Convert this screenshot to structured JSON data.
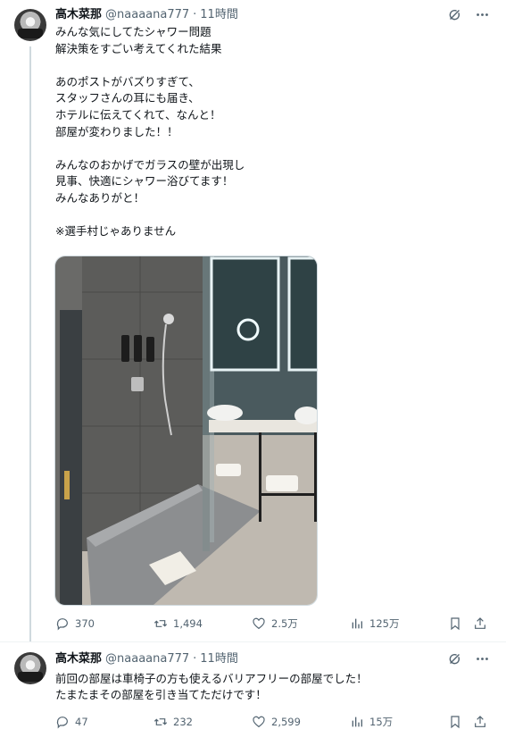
{
  "tweets": [
    {
      "author_name": "高木菜那",
      "handle": "@naaaana777",
      "separator": "·",
      "time": "11時間",
      "text": "みんな気にしてたシャワー問題\n解決策をすごい考えてくれた結果\n\nあのポストがバズりすぎて、\nスタッフさんの耳にも届き、\nホテルに伝えてくれて、なんと！\n部屋が変わりました！！\n\nみんなのおかげでガラスの壁が出現し\n見事、快適にシャワー浴びてます！\nみんなありがと！\n\n※選手村じゃありません",
      "stats": {
        "replies": "370",
        "reposts": "1,494",
        "likes": "2.5万",
        "views": "125万"
      }
    },
    {
      "author_name": "高木菜那",
      "handle": "@naaaana777",
      "separator": "·",
      "time": "11時間",
      "text": "前回の部屋は車椅子の方も使えるバリアフリーの部屋でした！\nたまたまその部屋を引き当てただけです！",
      "stats": {
        "replies": "47",
        "reposts": "232",
        "likes": "2,599",
        "views": "15万"
      }
    }
  ],
  "icons": {
    "grok": "grok-icon",
    "more": "more-icon",
    "reply": "reply-icon",
    "repost": "repost-icon",
    "like": "heart-icon",
    "views": "views-icon",
    "bookmark": "bookmark-icon",
    "share": "share-icon"
  },
  "colors": {
    "text": "#0f1419",
    "muted": "#536471",
    "line": "#cfd9de"
  }
}
